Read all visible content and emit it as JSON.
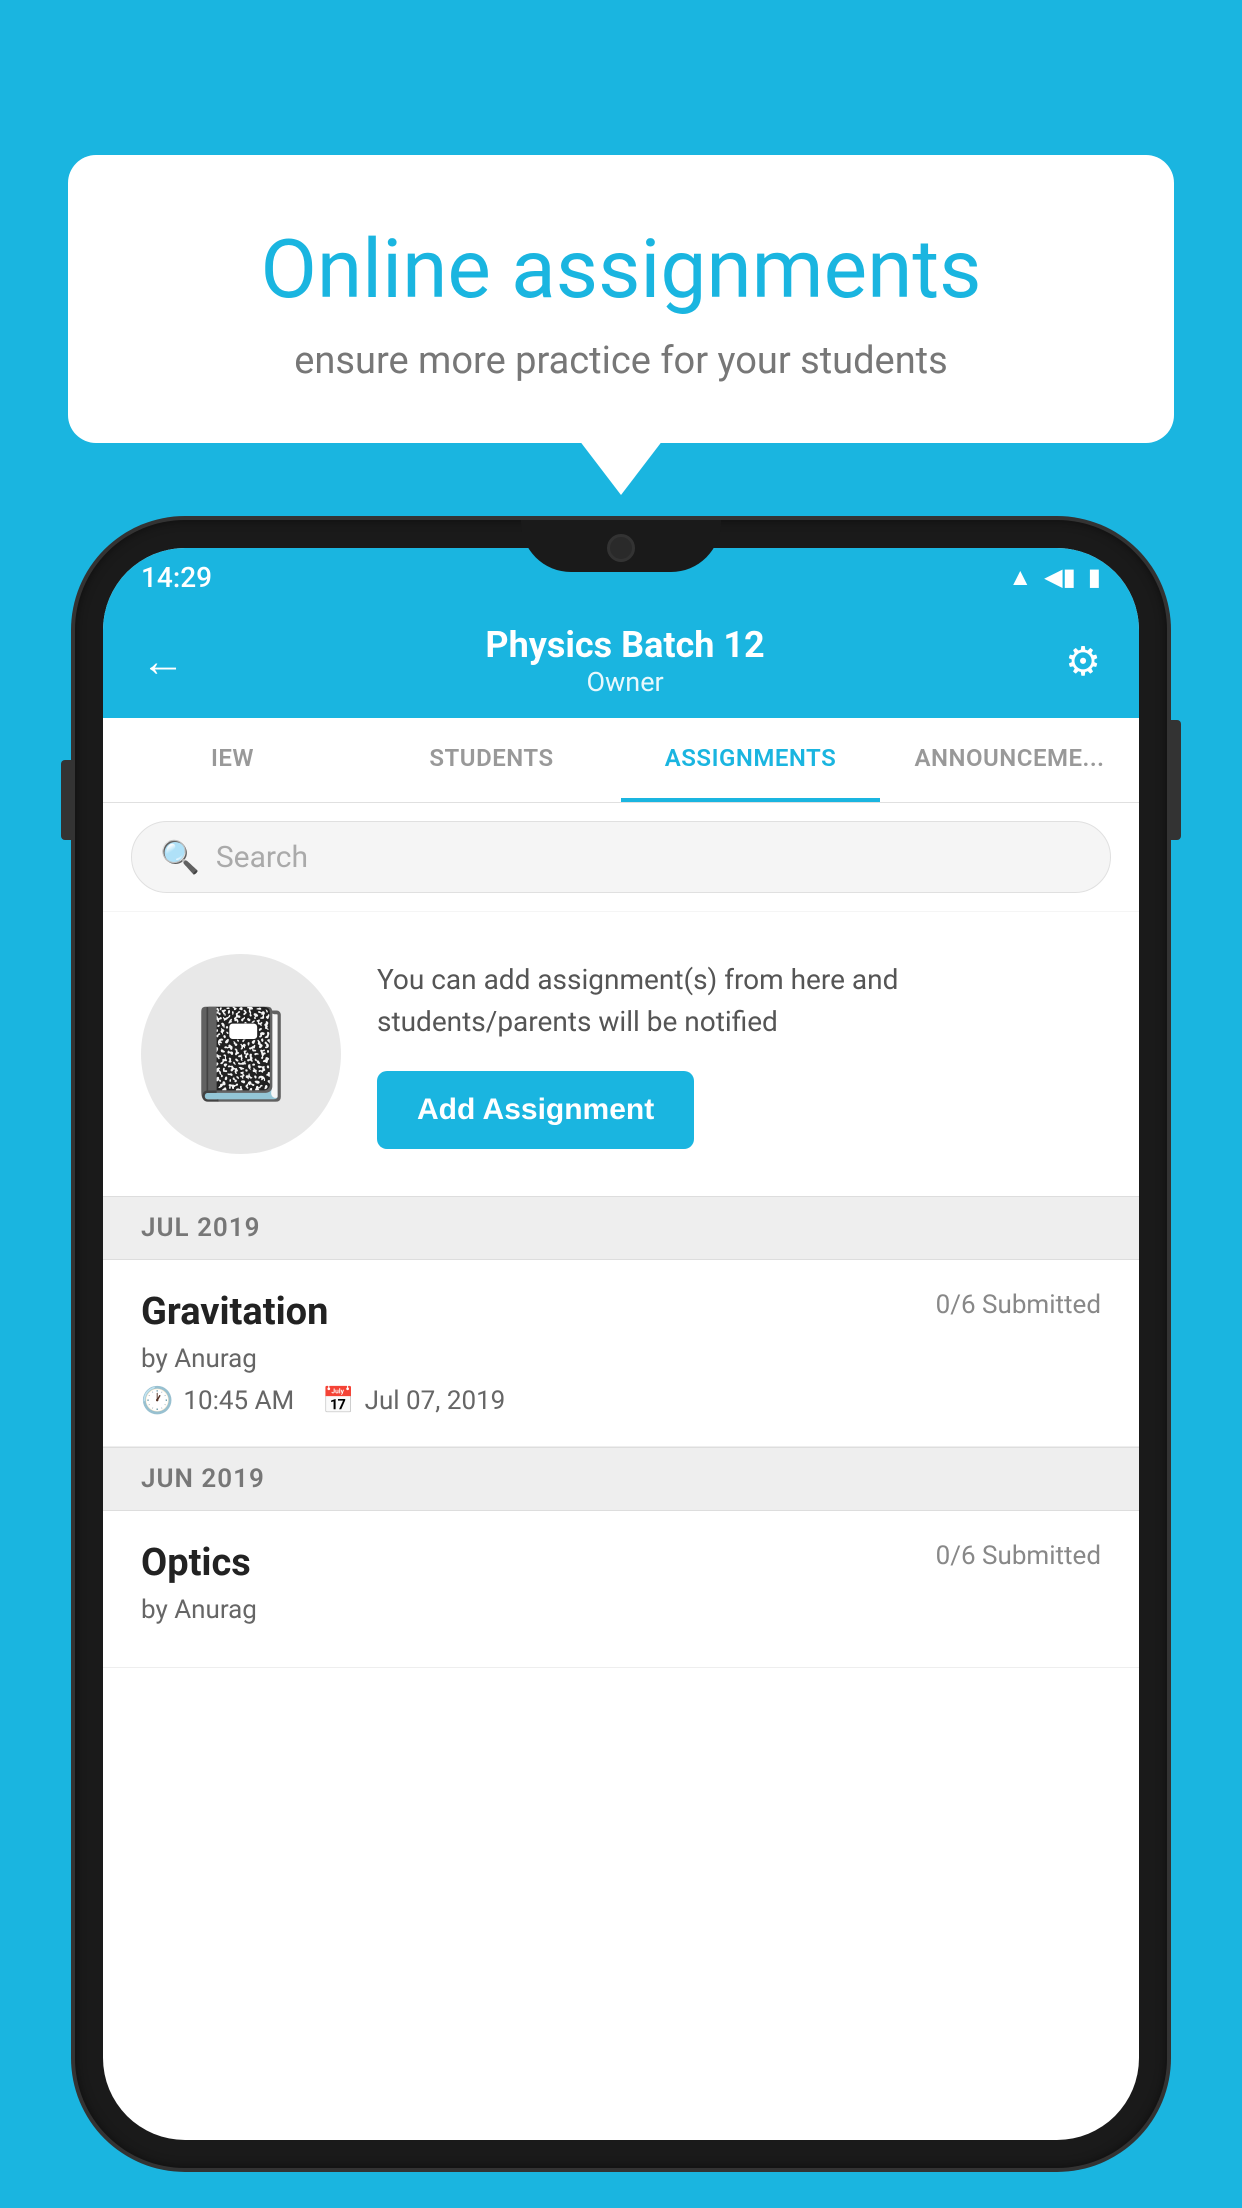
{
  "background_color": "#1ab5e0",
  "speech_bubble": {
    "title": "Online assignments",
    "subtitle": "ensure more practice for your students"
  },
  "phone": {
    "status_bar": {
      "time": "14:29",
      "icons": [
        "wifi",
        "signal",
        "battery"
      ]
    },
    "app_bar": {
      "title": "Physics Batch 12",
      "subtitle": "Owner",
      "back_label": "←",
      "settings_label": "⚙"
    },
    "tabs": [
      {
        "label": "IEW",
        "active": false
      },
      {
        "label": "STUDENTS",
        "active": false
      },
      {
        "label": "ASSIGNMENTS",
        "active": true
      },
      {
        "label": "ANNOUNCEMENTS",
        "active": false
      }
    ],
    "search": {
      "placeholder": "Search"
    },
    "add_assignment": {
      "description": "You can add assignment(s) from here and students/parents will be notified",
      "button_label": "Add Assignment"
    },
    "sections": [
      {
        "header": "JUL 2019",
        "assignments": [
          {
            "name": "Gravitation",
            "status": "0/6 Submitted",
            "by": "by Anurag",
            "time": "10:45 AM",
            "date": "Jul 07, 2019"
          }
        ]
      },
      {
        "header": "JUN 2019",
        "assignments": [
          {
            "name": "Optics",
            "status": "0/6 Submitted",
            "by": "by Anurag",
            "time": "",
            "date": ""
          }
        ]
      }
    ]
  }
}
